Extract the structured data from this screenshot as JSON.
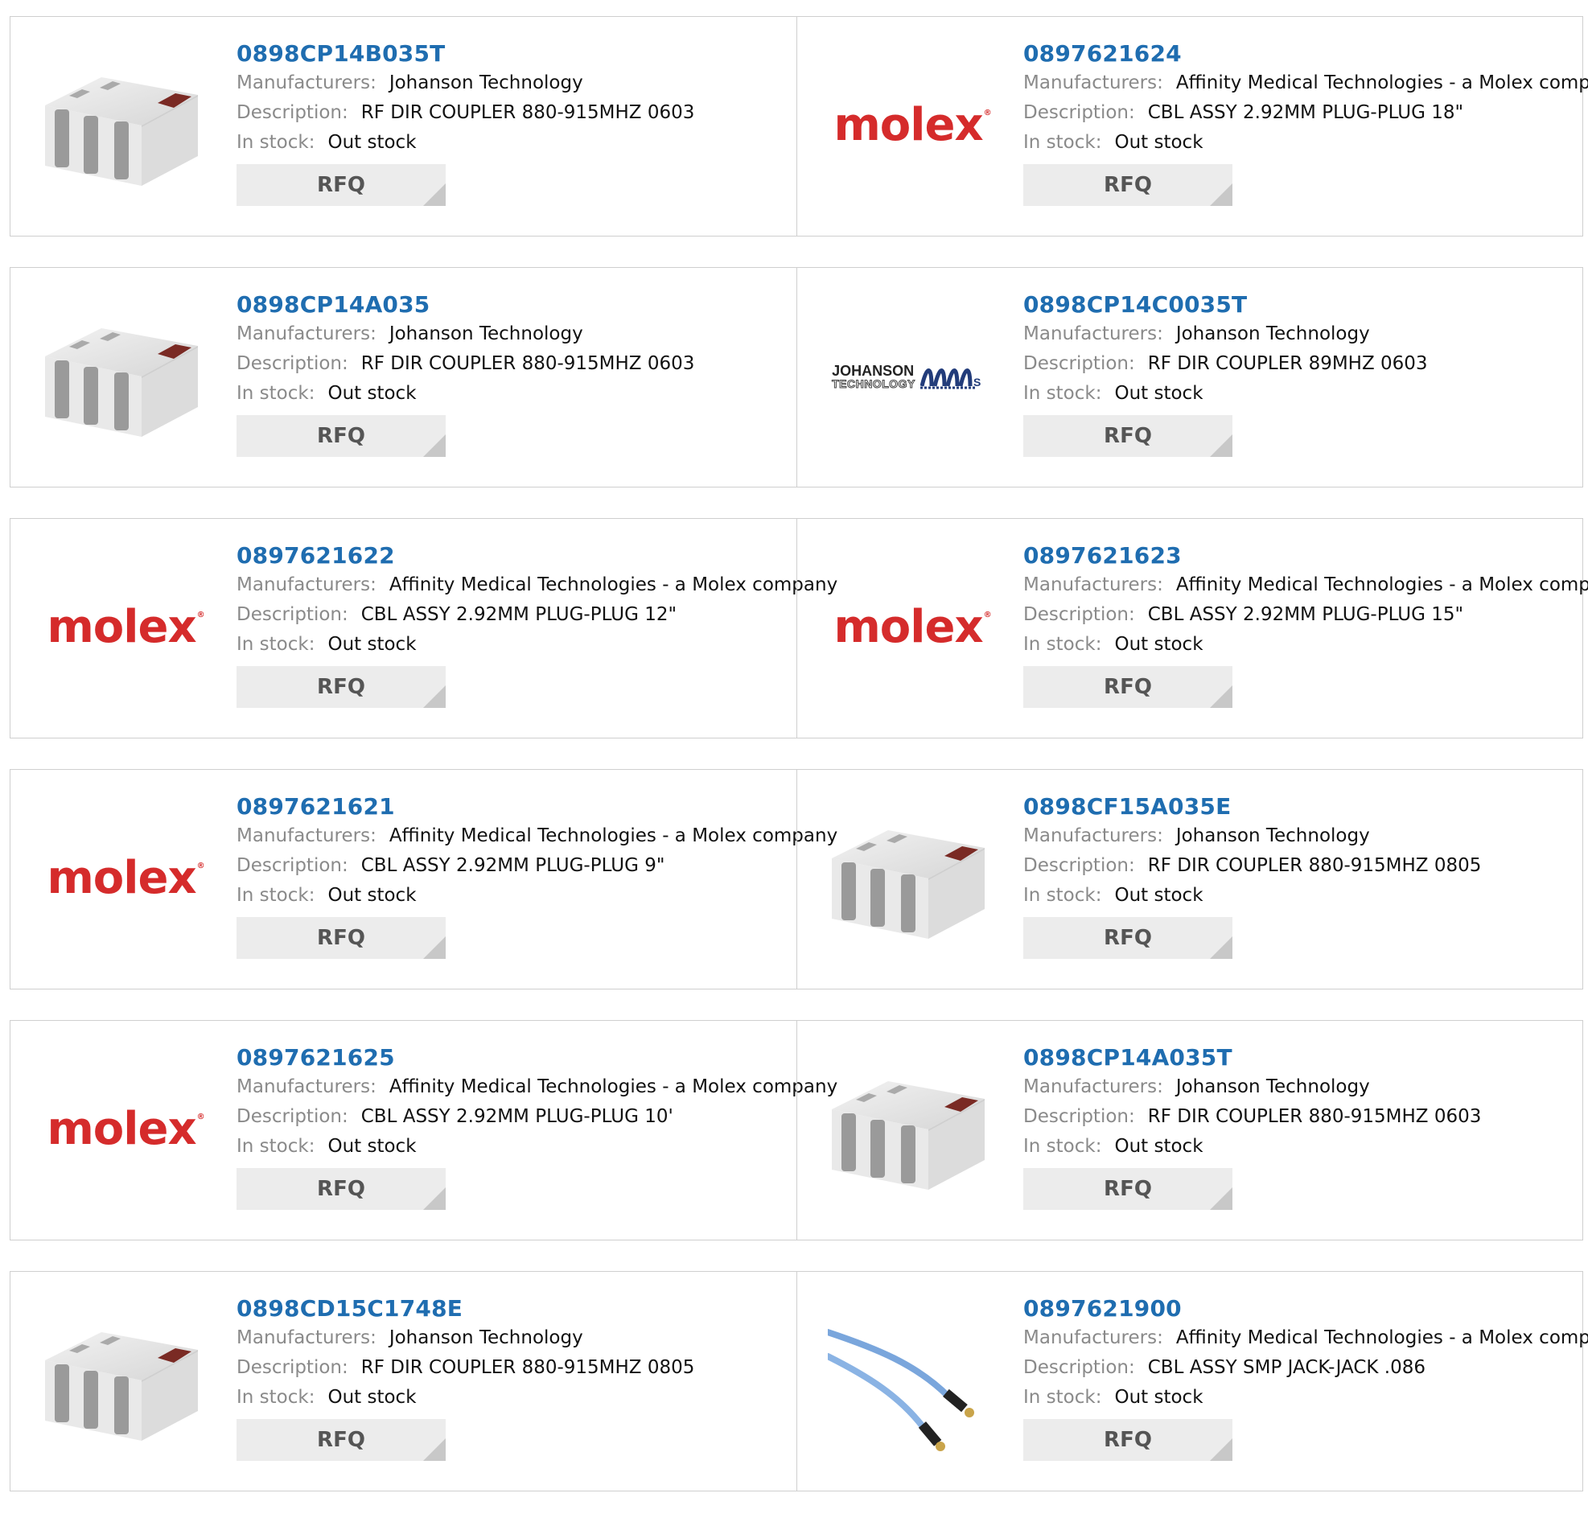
{
  "labels": {
    "manufacturers": "Manufacturers:",
    "description": "Description:",
    "stock": "In stock:",
    "rfq": "RFQ"
  },
  "logos": {
    "molex": "molex",
    "johanson_line1": "JOHANSON",
    "johanson_line2": "TECHNOLOGY"
  },
  "colors": {
    "link": "#1f6db0",
    "label": "#8a8a8a",
    "molex_red": "#d52b2b",
    "button_bg": "#ececec"
  },
  "products": [
    {
      "part": "0898CP14B035T",
      "manufacturer": "Johanson Technology",
      "description": "RF DIR COUPLER 880-915MHZ 0603",
      "stock": "Out stock",
      "image": "chip-icon"
    },
    {
      "part": "0897621624",
      "manufacturer": "Affinity Medical Technologies - a Molex company",
      "description": "CBL ASSY 2.92MM PLUG-PLUG 18\"",
      "stock": "Out stock",
      "image": "molex-logo"
    },
    {
      "part": "0898CP14A035",
      "manufacturer": "Johanson Technology",
      "description": "RF DIR COUPLER 880-915MHZ 0603",
      "stock": "Out stock",
      "image": "chip-icon"
    },
    {
      "part": "0898CP14C0035T",
      "manufacturer": "Johanson Technology",
      "description": "RF DIR COUPLER 89MHZ 0603",
      "stock": "Out stock",
      "image": "johanson-logo"
    },
    {
      "part": "0897621622",
      "manufacturer": "Affinity Medical Technologies - a Molex company",
      "description": "CBL ASSY 2.92MM PLUG-PLUG 12\"",
      "stock": "Out stock",
      "image": "molex-logo"
    },
    {
      "part": "0897621623",
      "manufacturer": "Affinity Medical Technologies - a Molex company",
      "description": "CBL ASSY 2.92MM PLUG-PLUG 15\"",
      "stock": "Out stock",
      "image": "molex-logo"
    },
    {
      "part": "0897621621",
      "manufacturer": "Affinity Medical Technologies - a Molex company",
      "description": "CBL ASSY 2.92MM PLUG-PLUG 9\"",
      "stock": "Out stock",
      "image": "molex-logo"
    },
    {
      "part": "0898CF15A035E",
      "manufacturer": "Johanson Technology",
      "description": "RF DIR COUPLER 880-915MHZ 0805",
      "stock": "Out stock",
      "image": "chip-icon"
    },
    {
      "part": "0897621625",
      "manufacturer": "Affinity Medical Technologies - a Molex company",
      "description": "CBL ASSY 2.92MM PLUG-PLUG 10'",
      "stock": "Out stock",
      "image": "molex-logo"
    },
    {
      "part": "0898CP14A035T",
      "manufacturer": "Johanson Technology",
      "description": "RF DIR COUPLER 880-915MHZ 0603",
      "stock": "Out stock",
      "image": "chip-icon"
    },
    {
      "part": "0898CD15C1748E",
      "manufacturer": "Johanson Technology",
      "description": "RF DIR COUPLER 880-915MHZ 0805",
      "stock": "Out stock",
      "image": "chip-icon"
    },
    {
      "part": "0897621900",
      "manufacturer": "Affinity Medical Technologies - a Molex company",
      "description": "CBL ASSY SMP JACK-JACK .086",
      "stock": "Out stock",
      "image": "cable-icon"
    }
  ]
}
